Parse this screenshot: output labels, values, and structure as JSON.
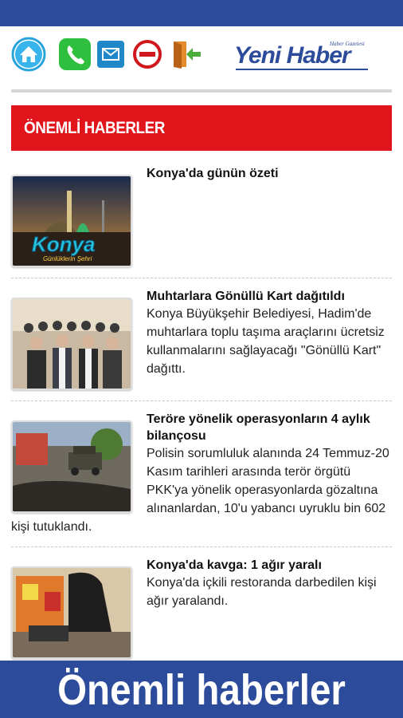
{
  "brand": {
    "logo_text": "Yeni Haber",
    "logo_tagline": "Haber Gazetesi"
  },
  "toolbar": {
    "icons": [
      "home-icon",
      "phone-icon",
      "mail-icon",
      "block-icon",
      "exit-icon"
    ]
  },
  "section": {
    "title": "ÖNEMLİ HABERLER"
  },
  "news": [
    {
      "title": "Konya'da günün özeti",
      "summary": "",
      "thumb_text": "Konya",
      "thumb_sub": "Günlüklerin Şehri"
    },
    {
      "title": "Muhtarlara Gönüllü Kart dağıtıldı",
      "summary": "Konya Büyükşehir Belediyesi, Hadim'de muhtarlara toplu taşıma araçlarını ücretsiz kullanmalarını sağlayacağı \"Gönüllü Kart\" dağıttı."
    },
    {
      "title": "Teröre yönelik operasyonların 4 aylık bilançosu",
      "summary": "Polisin sorumluluk alanında 24 Temmuz-20 Kasım tarihleri arasında terör örgütü PKK'ya yönelik operasyonlarda gözaltına alınanlardan, 10'u yabancı uyruklu bin 602 kişi tutuklandı."
    },
    {
      "title": "Konya'da kavga: 1 ağır yaralı",
      "summary": "Konya'da içkili restoranda darbedilen kişi ağır yaralandı."
    }
  ],
  "banner": {
    "text": "Önemli haberler"
  },
  "colors": {
    "header_blue": "#2d4b9b",
    "section_red": "#e1141c",
    "logo_blue": "#2c4b9a"
  }
}
